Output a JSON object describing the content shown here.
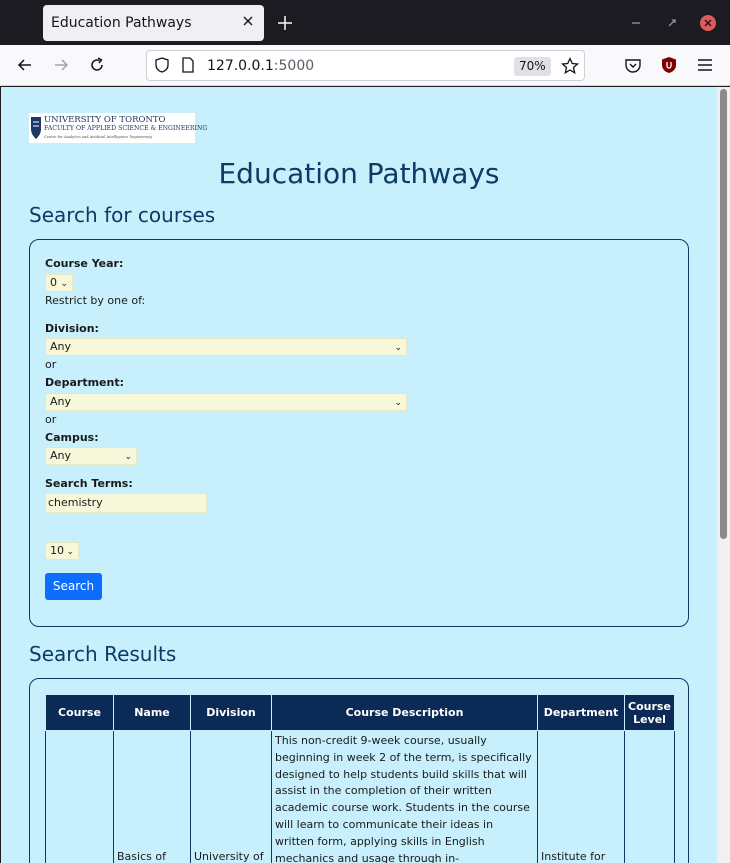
{
  "browser": {
    "tab_title": "Education Pathways",
    "url_host": "127.0.0.1",
    "url_port": ":5000",
    "zoom": "70%"
  },
  "page": {
    "logo_text_1": "UNIVERSITY OF TORONTO",
    "logo_text_2": "FACULTY OF APPLIED SCIENCE & ENGINEERING",
    "logo_text_3": "Centre for Analytics and Artificial Intelligence Engineering",
    "heading": "Education Pathways",
    "search_title": "Search for courses",
    "results_title": "Search Results"
  },
  "form": {
    "course_year_label": "Course Year:",
    "course_year_value": "0",
    "restrict_text": "Restrict by one of:",
    "division_label": "Division:",
    "division_value": "Any",
    "or_1": "or",
    "department_label": "Department:",
    "department_value": "Any",
    "or_2": "or",
    "campus_label": "Campus:",
    "campus_value": "Any",
    "search_terms_label": "Search Terms:",
    "search_terms_value": "chemistry",
    "results_count": "10",
    "search_button": "Search"
  },
  "table": {
    "headers": [
      "Course",
      "Name",
      "Division",
      "Course Description",
      "Department",
      "Course Level"
    ],
    "row1": {
      "course": "",
      "name": "Basics of",
      "division": "University of",
      "description": "This non-credit 9-week course, usually beginning in week 2 of the term, is specifically designed to help students build skills that will assist in the completion of their written academic course work. Students in the course will learn to communicate their ideas in written form, applying skills in English mechanics and usage through in-",
      "department": "Institute for",
      "level": ""
    }
  }
}
